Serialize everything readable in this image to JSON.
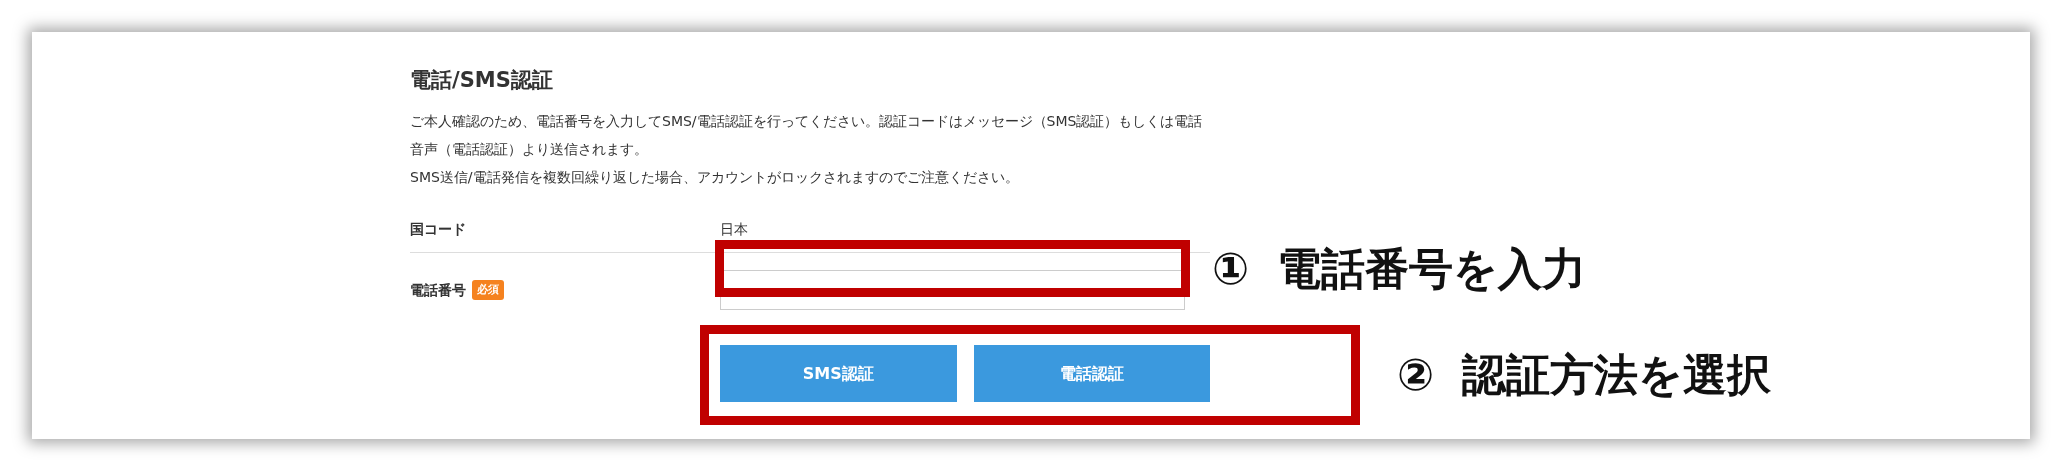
{
  "section": {
    "title": "電話/SMS認証",
    "description": [
      "ご本人確認のため、電話番号を入力してSMS/電話認証を行ってください。認証コードはメッセージ（SMS認証）もしくは電話音声（電話認証）より送信されます。",
      "SMS送信/電話発信を複数回繰り返した場合、アカウントがロックされますのでご注意ください。"
    ]
  },
  "fields": [
    {
      "kind": "text",
      "label": "国コード",
      "value": "日本"
    },
    {
      "kind": "input",
      "label": "電話番号",
      "badge": "必須"
    }
  ],
  "buttons": [
    "SMS認証",
    "電話認証"
  ],
  "annotations": [
    {
      "number": "①",
      "text": "電話番号を入力"
    },
    {
      "number": "②",
      "text": "認証方法を選択"
    }
  ]
}
